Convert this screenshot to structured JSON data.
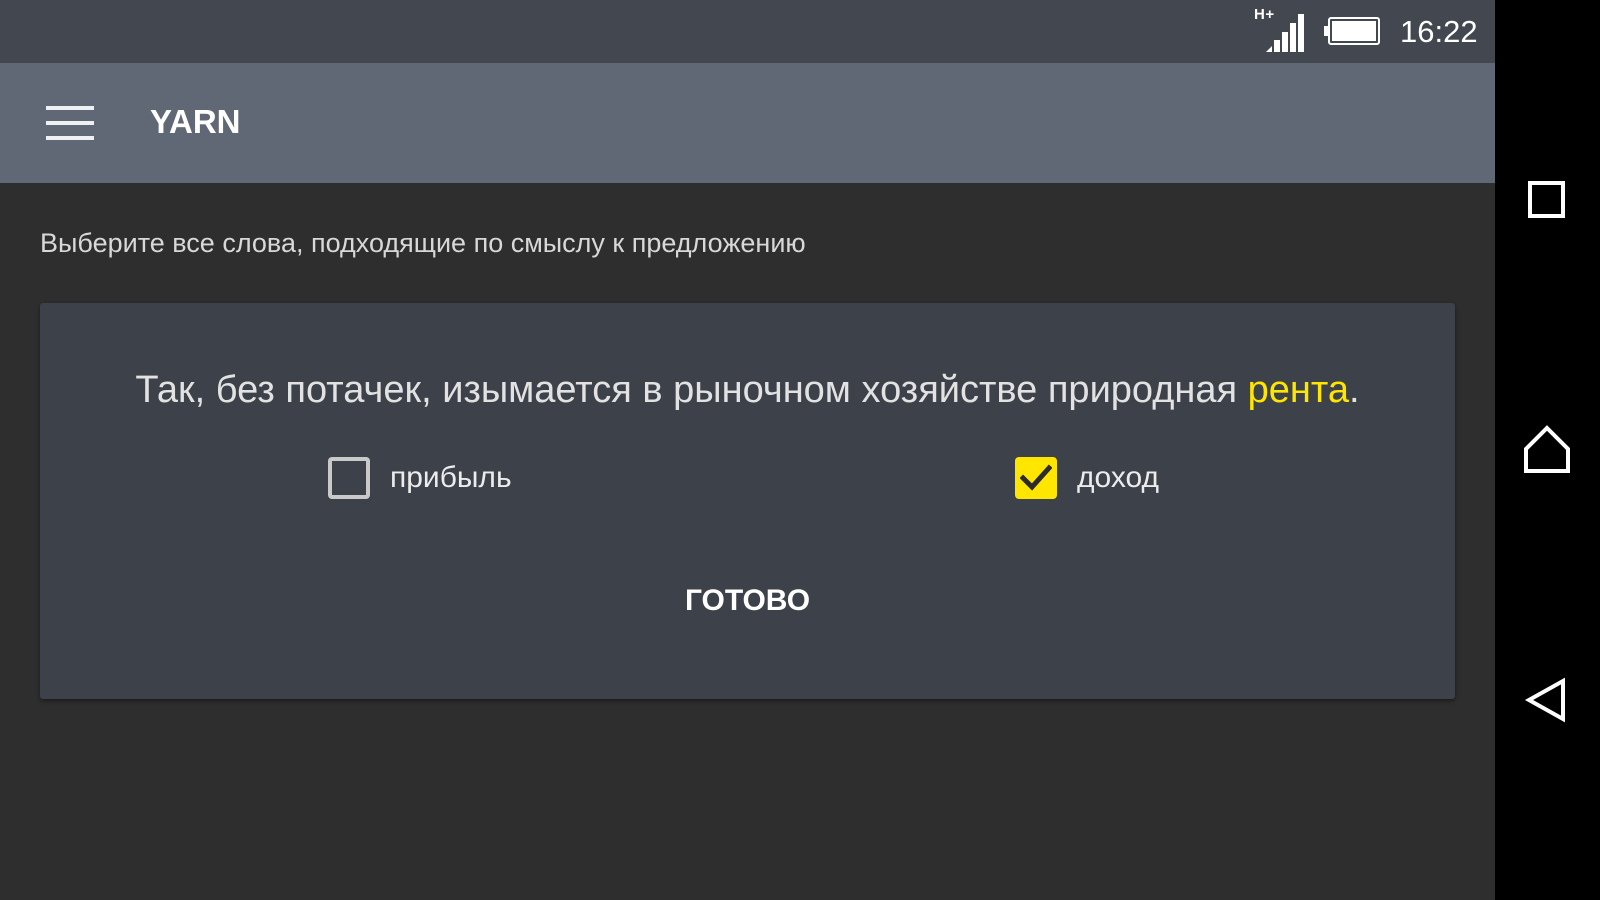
{
  "status_bar": {
    "network_type": "H+",
    "time": "16:22",
    "icons": [
      "signal-icon",
      "battery-icon"
    ]
  },
  "app_bar": {
    "title": "YARN",
    "menu_icon": "hamburger-menu-icon"
  },
  "instruction": "Выберите все слова, подходящие по смыслу к предложению",
  "card": {
    "sentence_before": "Так, без потачек, изымается в рыночном хозяйстве природная ",
    "sentence_highlight": "рента",
    "sentence_after": ".",
    "options": [
      {
        "label": "прибыль",
        "checked": false
      },
      {
        "label": "доход",
        "checked": true
      }
    ],
    "done_label": "ГОТОВО"
  },
  "nav_bar": {
    "icons": [
      "recents-icon",
      "home-icon",
      "back-icon"
    ]
  },
  "colors": {
    "status_bar": "#424750",
    "app_bar": "#616875",
    "background": "#2e2e2e",
    "card": "#3d414a",
    "accent": "#ffe600"
  }
}
